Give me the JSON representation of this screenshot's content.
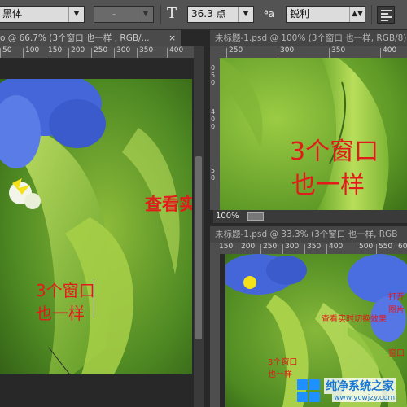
{
  "options_bar": {
    "font_family": "黑体",
    "font_style": "-",
    "font_size": "36.3 点",
    "antialias": "锐利"
  },
  "documents": [
    {
      "tab_title": "o @ 66.7% (3个窗口 也一样 , RGB/...",
      "close": "×",
      "ruler_ticks": [
        "50",
        "100",
        "150",
        "200",
        "250",
        "300",
        "350",
        "400"
      ],
      "image_texts": {
        "partial": "查看实",
        "main_line1": "3个窗口",
        "main_line2": "也一样"
      }
    },
    {
      "tab_title": "未标题-1.psd @ 100% (3个窗口 也一样, RGB/8)",
      "ruler_ticks": [
        "250",
        "300",
        "350",
        "400"
      ],
      "vruler_ticks": [
        "0",
        "5",
        "0",
        "4",
        "0",
        "0",
        "5",
        "0"
      ],
      "image_texts": {
        "line1": "3个窗口",
        "line2": "也一样"
      },
      "zoom": "100%"
    },
    {
      "tab_title": "未标题-1.psd @ 33.3% (3个窗口 也一样, RGB",
      "ruler_ticks": [
        "150",
        "200",
        "250",
        "300",
        "350",
        "400",
        "500",
        "550",
        "600"
      ],
      "image_texts": {
        "main": "查看实时切换效果",
        "right_top": "打开",
        "right_mid": "图片",
        "right_low": "窗口",
        "small_line1": "3个窗口",
        "small_line2": "也一样"
      }
    }
  ],
  "watermark": {
    "title": "纯净系统之家",
    "url": "www.ycwjzy.com"
  },
  "colors": {
    "accent_red": "#e31a1a",
    "panel": "#535353",
    "background": "#282828"
  }
}
